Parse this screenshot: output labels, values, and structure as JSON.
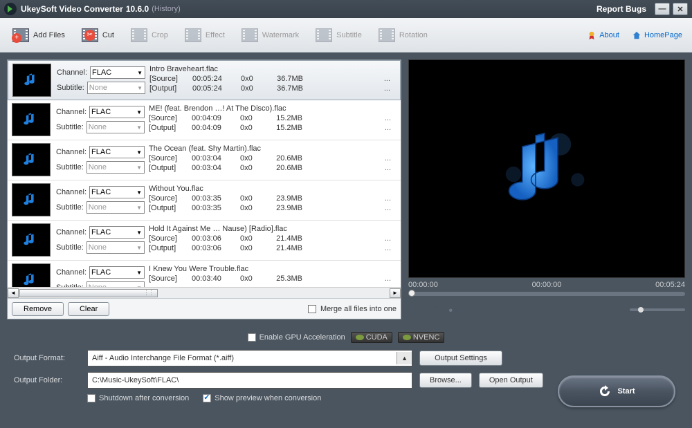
{
  "window": {
    "title": "UkeySoft Video Converter",
    "version": "10.6.0",
    "history": "(History)",
    "report_bugs": "Report Bugs"
  },
  "toolbar": {
    "add_files": "Add Files",
    "cut": "Cut",
    "crop": "Crop",
    "effect": "Effect",
    "watermark": "Watermark",
    "subtitle": "Subtitle",
    "rotation": "Rotation",
    "about": "About",
    "homepage": "HomePage"
  },
  "files": [
    {
      "channel": "FLAC",
      "subtitle": "None",
      "name": "Intro  Braveheart.flac",
      "src_dur": "00:05:24",
      "src_res": "0x0",
      "src_size": "36.7MB",
      "out_dur": "00:05:24",
      "out_res": "0x0",
      "out_size": "36.7MB",
      "selected": true
    },
    {
      "channel": "FLAC",
      "subtitle": "None",
      "name": "ME! (feat. Brendon …! At The Disco).flac",
      "src_dur": "00:04:09",
      "src_res": "0x0",
      "src_size": "15.2MB",
      "out_dur": "00:04:09",
      "out_res": "0x0",
      "out_size": "15.2MB",
      "selected": false
    },
    {
      "channel": "FLAC",
      "subtitle": "None",
      "name": "The Ocean (feat. Shy Martin).flac",
      "src_dur": "00:03:04",
      "src_res": "0x0",
      "src_size": "20.6MB",
      "out_dur": "00:03:04",
      "out_res": "0x0",
      "out_size": "20.6MB",
      "selected": false
    },
    {
      "channel": "FLAC",
      "subtitle": "None",
      "name": "Without You.flac",
      "src_dur": "00:03:35",
      "src_res": "0x0",
      "src_size": "23.9MB",
      "out_dur": "00:03:35",
      "out_res": "0x0",
      "out_size": "23.9MB",
      "selected": false
    },
    {
      "channel": "FLAC",
      "subtitle": "None",
      "name": "Hold It Against Me … Nause) [Radio].flac",
      "src_dur": "00:03:06",
      "src_res": "0x0",
      "src_size": "21.4MB",
      "out_dur": "00:03:06",
      "out_res": "0x0",
      "out_size": "21.4MB",
      "selected": false
    },
    {
      "channel": "FLAC",
      "subtitle": "None",
      "name": "I Knew You Were Trouble.flac",
      "src_dur": "00:03:40",
      "src_res": "0x0",
      "src_size": "25.3MB",
      "out_dur": "",
      "out_res": "",
      "out_size": "",
      "selected": false
    }
  ],
  "labels": {
    "channel": "Channel:",
    "subtitle": "Subtitle:",
    "source": "[Source]",
    "output": "[Output]",
    "remove": "Remove",
    "clear": "Clear",
    "merge": "Merge all files into one"
  },
  "preview": {
    "t1": "00:00:00",
    "t2": "00:00:00",
    "t3": "00:05:24"
  },
  "gpu": {
    "enable": "Enable GPU Acceleration",
    "cuda": "CUDA",
    "nvenc": "NVENC"
  },
  "output": {
    "format_label": "Output Format:",
    "format_value": "Aiff - Audio Interchange File Format (*.aiff)",
    "folder_label": "Output Folder:",
    "folder_value": "C:\\Music-UkeySoft\\FLAC\\",
    "settings": "Output Settings",
    "browse": "Browse...",
    "open": "Open Output",
    "shutdown": "Shutdown after conversion",
    "preview": "Show preview when conversion"
  },
  "start": "Start"
}
